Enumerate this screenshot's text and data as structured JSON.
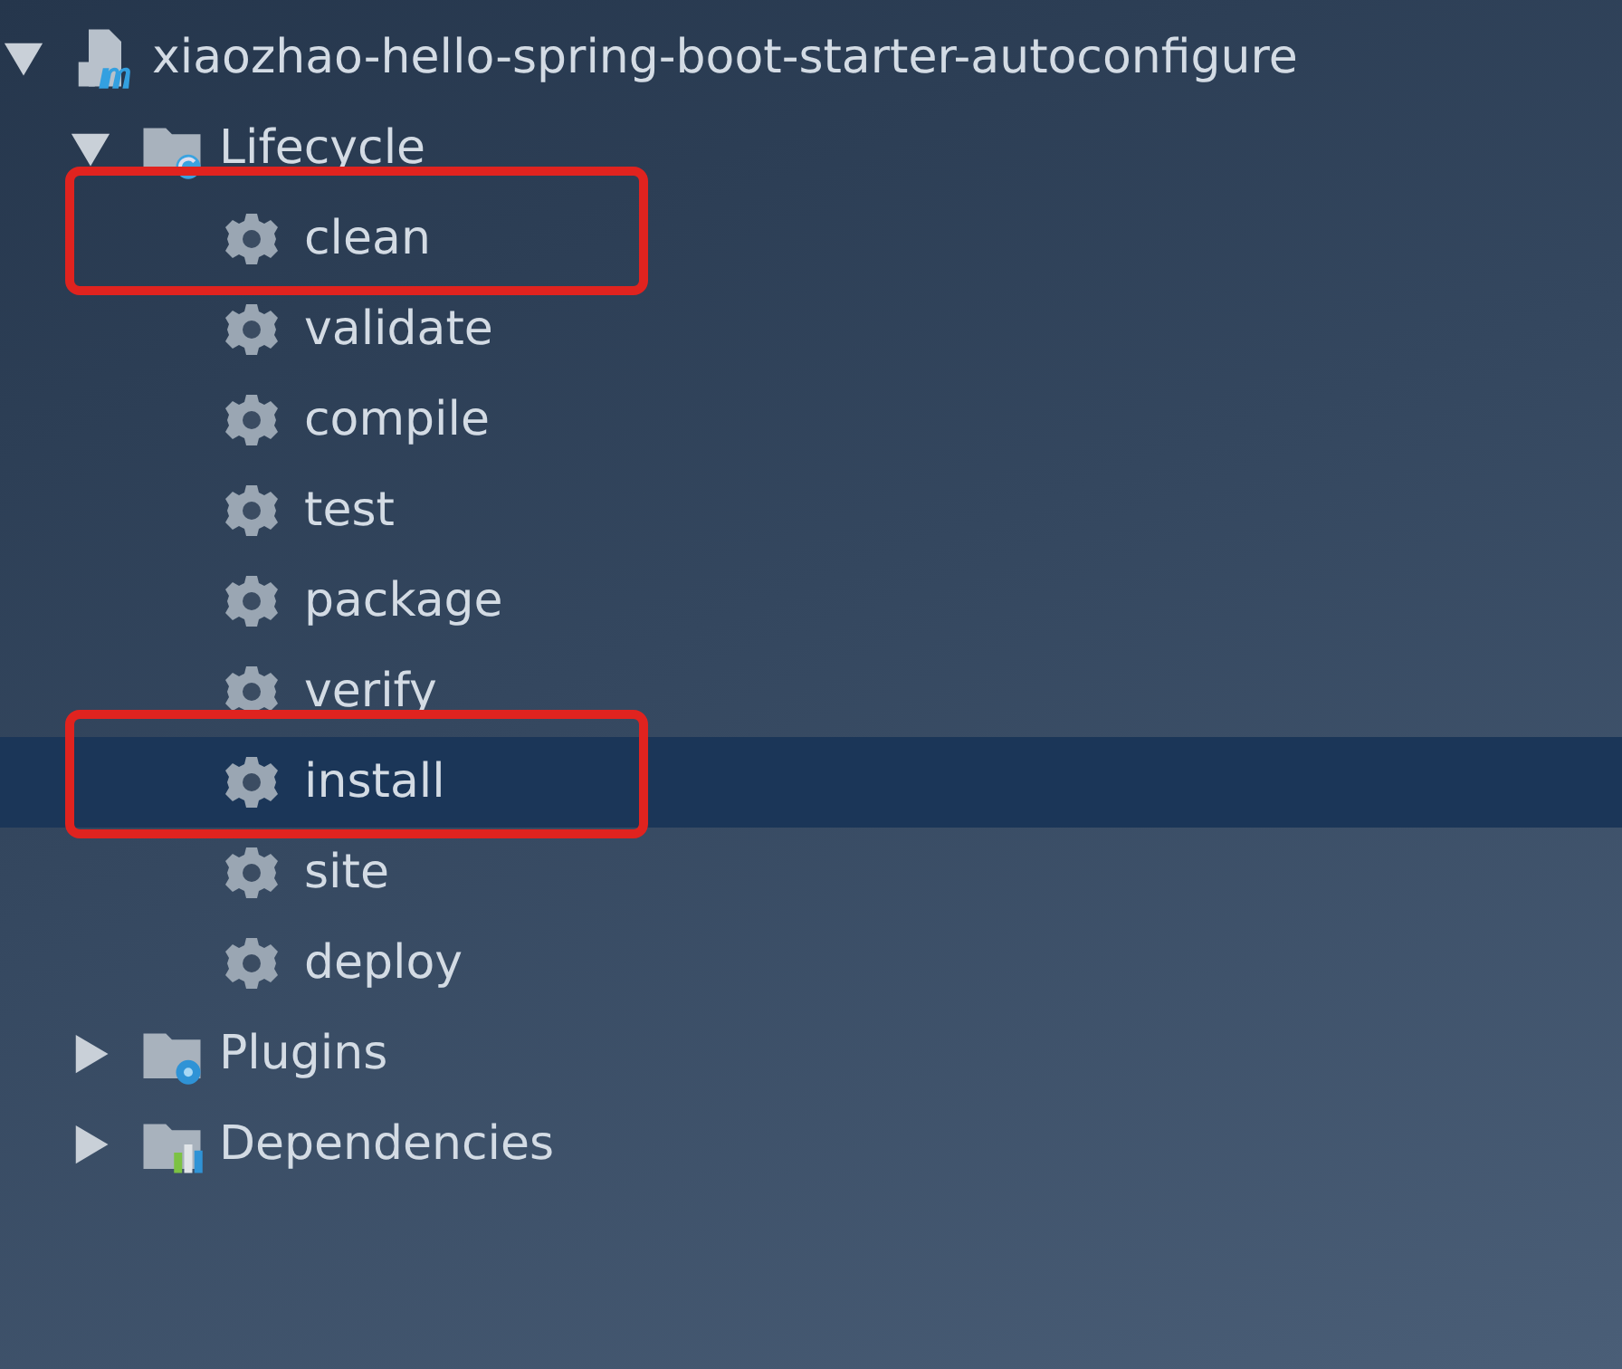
{
  "tree": [
    {
      "label": "xiaozhao-hello-spring-boot-starter-autoconfigure",
      "kind": "module",
      "expanded": true,
      "children": [
        {
          "label": "Lifecycle",
          "kind": "lifecycle",
          "expanded": true,
          "children": [
            {
              "label": "clean",
              "kind": "goal",
              "selected": false,
              "annotated": true
            },
            {
              "label": "validate",
              "kind": "goal",
              "selected": false,
              "annotated": false
            },
            {
              "label": "compile",
              "kind": "goal",
              "selected": false,
              "annotated": false
            },
            {
              "label": "test",
              "kind": "goal",
              "selected": false,
              "annotated": false
            },
            {
              "label": "package",
              "kind": "goal",
              "selected": false,
              "annotated": false
            },
            {
              "label": "verify",
              "kind": "goal",
              "selected": false,
              "annotated": false
            },
            {
              "label": "install",
              "kind": "goal",
              "selected": true,
              "annotated": true
            },
            {
              "label": "site",
              "kind": "goal",
              "selected": false,
              "annotated": false
            },
            {
              "label": "deploy",
              "kind": "goal",
              "selected": false,
              "annotated": false
            }
          ]
        },
        {
          "label": "Plugins",
          "kind": "plugins",
          "expanded": false
        },
        {
          "label": "Dependencies",
          "kind": "dependencies",
          "expanded": false
        }
      ]
    }
  ]
}
